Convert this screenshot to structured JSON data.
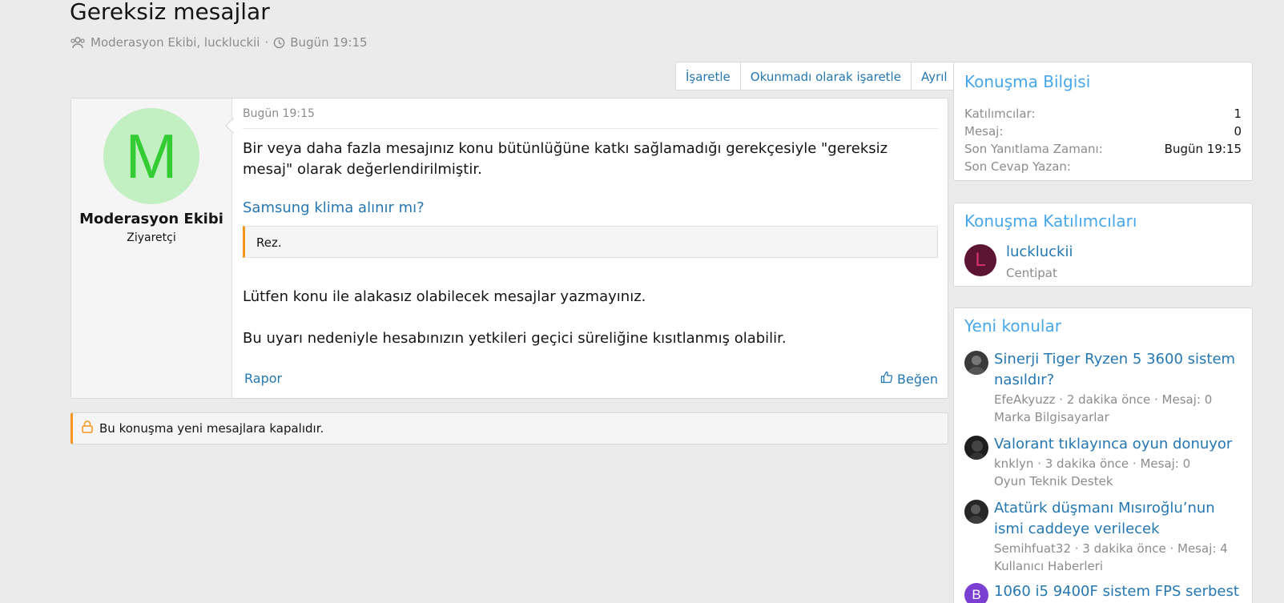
{
  "header": {
    "title": "Gereksiz mesajlar",
    "participants": "Moderasyon Ekibi, luckluckii",
    "separator": "·",
    "time": "Bugün 19:15"
  },
  "actions": {
    "mark": "İşaretle",
    "mark_unread": "Okunmadı olarak işaretle",
    "leave": "Ayrıl"
  },
  "message": {
    "avatar_letter": "M",
    "avatar_bg": "#c2f0c2",
    "avatar_fg": "#33cc33",
    "author": "Moderasyon Ekibi",
    "user_title": "Ziyaretçi",
    "date": "Bugün 19:15",
    "text1": "Bir veya daha fazla mesajınız konu bütünlüğüne katkı sağlamadığı gerekçesiyle \"gereksiz mesaj\" olarak değerlendirilmiştir.",
    "thread_link": "Samsung klima alınır mı?",
    "quote": "Rez.",
    "text2": "Lütfen konu ile alakasız olabilecek mesajlar yazmayınız.",
    "text3": "Bu uyarı nedeniyle hesabınızın yetkileri geçici süreliğine kısıtlanmış olabilir.",
    "report": "Rapor",
    "like": "Beğen"
  },
  "closed_notice": "Bu konuşma yeni mesajlara kapalıdır.",
  "sidebar": {
    "info": {
      "title": "Konuşma Bilgisi",
      "rows": [
        {
          "label": "Katılımcılar:",
          "value": "1"
        },
        {
          "label": "Mesaj:",
          "value": "0"
        },
        {
          "label": "Son Yanıtlama Zamanı:",
          "value": "Bugün 19:15"
        },
        {
          "label": "Son Cevap Yazan:",
          "value": ""
        }
      ]
    },
    "participants": {
      "title": "Konuşma Katılımcıları",
      "items": [
        {
          "letter": "L",
          "name": "luckluckii",
          "title": "Centipat"
        }
      ]
    },
    "new_threads": {
      "title": "Yeni konular",
      "items": [
        {
          "title": "Sinerji Tiger Ryzen 5 3600 sistem nasıldır?",
          "meta": "EfeAkyuzz · 2 dakika önce · Mesaj: 0",
          "forum": "Marka Bilgisayarlar"
        },
        {
          "title": "Valorant tıklayınca oyun donuyor",
          "meta": "knklyn · 3 dakika önce · Mesaj: 0",
          "forum": "Oyun Teknik Destek"
        },
        {
          "title": "Atatürk düşmanı Mısıroğlu’nun ismi caddeye verilecek",
          "meta": "Semihfuat32 · 3 dakika önce · Mesaj: 4",
          "forum": "Kullanıcı Haberleri"
        },
        {
          "title": "1060 i5 9400F sistem FPS serbest",
          "avatar_letter": "B"
        }
      ]
    }
  },
  "colors": {
    "accent": "#2577b1",
    "block_title": "#47a7eb",
    "warning": "#f7941d"
  }
}
